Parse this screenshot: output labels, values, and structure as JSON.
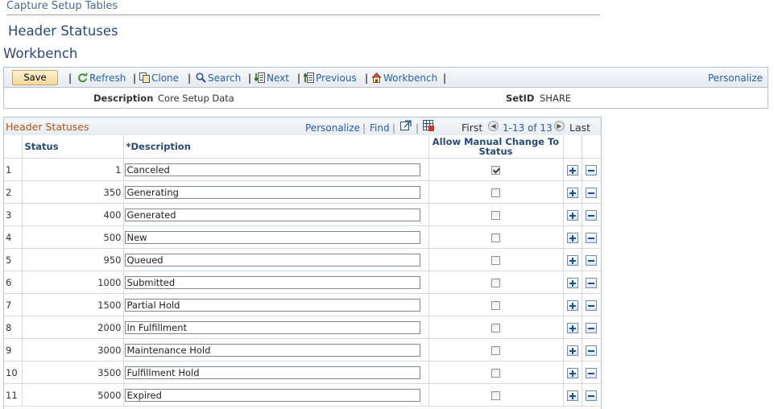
{
  "breadcrumb": "Capture Setup Tables",
  "page_title": "Header Statuses",
  "section_title": "Workbench",
  "toolbar": {
    "save_label": "Save",
    "refresh_label": "Refresh",
    "clone_label": "Clone",
    "search_label": "Search",
    "next_label": "Next",
    "previous_label": "Previous",
    "workbench_label": "Workbench",
    "separator": "|",
    "personalize_label": "Personalize"
  },
  "info": {
    "description_label": "Description",
    "description_value": "Core Setup Data",
    "setid_label": "SetID",
    "setid_value": "SHARE"
  },
  "grid": {
    "title": "Header Statuses",
    "personalize_label": "Personalize",
    "find_label": "Find",
    "separator": "|",
    "first_label": "First",
    "range_label": "1-13 of 13",
    "last_label": "Last",
    "columns": {
      "status": "Status",
      "description": "*Description",
      "allow_manual": "Allow Manual Change To Status"
    },
    "rows": [
      {
        "num": "1",
        "status": "1",
        "description": "Canceled",
        "checked": true
      },
      {
        "num": "2",
        "status": "350",
        "description": "Generating",
        "checked": false
      },
      {
        "num": "3",
        "status": "400",
        "description": "Generated",
        "checked": false
      },
      {
        "num": "4",
        "status": "500",
        "description": "New",
        "checked": false
      },
      {
        "num": "5",
        "status": "950",
        "description": "Queued",
        "checked": false
      },
      {
        "num": "6",
        "status": "1000",
        "description": "Submitted",
        "checked": false
      },
      {
        "num": "7",
        "status": "1500",
        "description": "Partial Hold",
        "checked": false
      },
      {
        "num": "8",
        "status": "2000",
        "description": "In Fulfillment",
        "checked": false
      },
      {
        "num": "9",
        "status": "3000",
        "description": "Maintenance Hold",
        "checked": false
      },
      {
        "num": "10",
        "status": "3500",
        "description": "Fulfillment Hold",
        "checked": false
      },
      {
        "num": "11",
        "status": "5000",
        "description": "Expired",
        "checked": false
      }
    ]
  },
  "colors": {
    "link": "#2b5ea5",
    "title": "#2b4a74",
    "grid_title": "#b0531a",
    "save_button": "#f3d89a"
  },
  "icons": {
    "refresh": "refresh-icon",
    "clone": "clone-icon",
    "search": "search-icon",
    "next": "next-icon",
    "previous": "previous-icon",
    "workbench": "workbench-icon",
    "view_all": "view-all-icon",
    "download": "download-icon",
    "add_row": "add-row-icon",
    "delete_row": "delete-row-icon"
  }
}
